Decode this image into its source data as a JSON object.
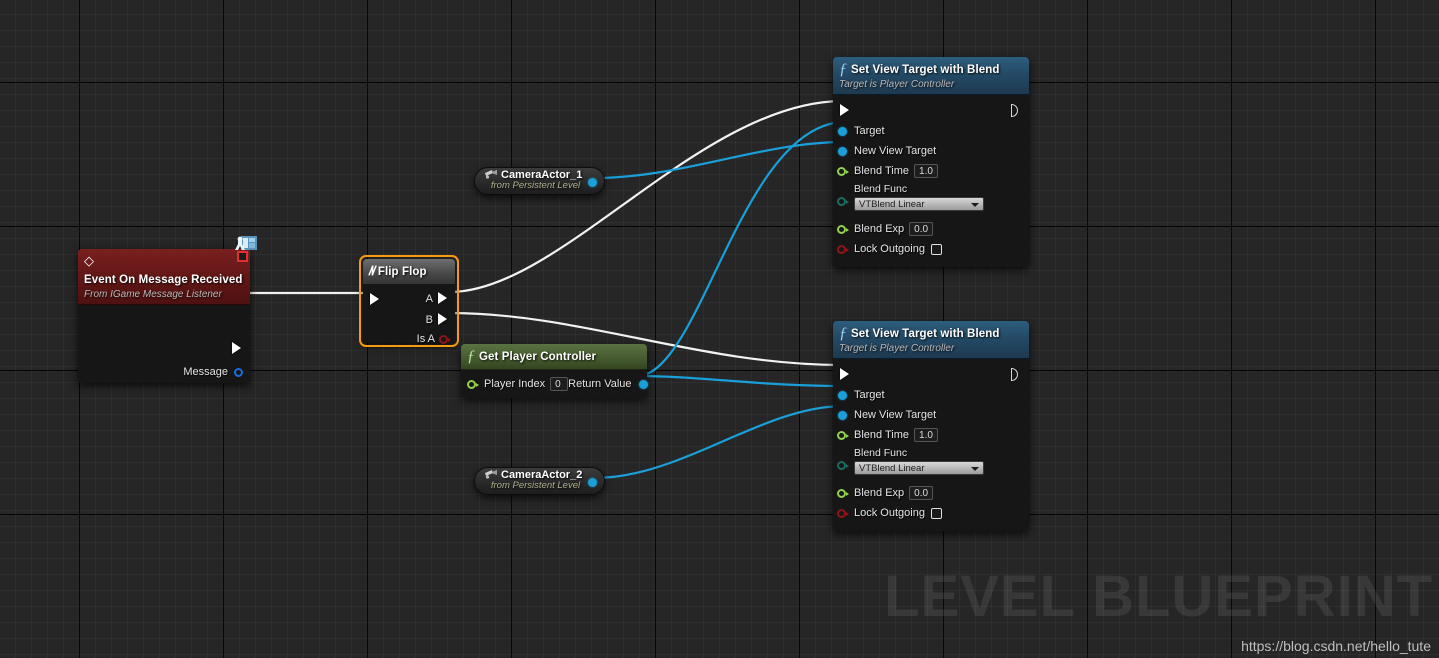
{
  "graph": {
    "watermark": "LEVEL BLUEPRINT",
    "url": "https://blog.csdn.net/hello_tute",
    "colors": {
      "exec_wire": "#f2f2f2",
      "object_wire": "#1a9fd8",
      "selection": "#f59b12",
      "header_function": "#2e5d7e",
      "header_pure": "#5a7342",
      "header_event": "#7a1f1f",
      "header_flow": "#6e6e6e",
      "pin_object": "#1a9fd8",
      "pin_float": "#92d050",
      "pin_enum": "#1b6b63",
      "pin_bool": "#8c1616",
      "canvas_bg": "#262626"
    }
  },
  "nodes": {
    "event": {
      "title": "Event On Message Received",
      "subtitle": "From IGame Message Listener",
      "icon": "event-diamond-icon",
      "badge": "blueprint-actor-badge-icon",
      "out_exec": "exec-out-pin",
      "message_pin_label": "Message"
    },
    "flipflop": {
      "title": "Flip Flop",
      "icon": "flow-control-icon",
      "selected": true,
      "in_exec": "exec-in-pin",
      "outputs": [
        {
          "label": "A",
          "type": "exec"
        },
        {
          "label": "B",
          "type": "exec"
        },
        {
          "label": "Is A",
          "type": "bool"
        }
      ]
    },
    "get_player_controller": {
      "title": "Get Player Controller",
      "icon": "pure-function-icon",
      "input_label": "Player Index",
      "input_value": "0",
      "output_label": "Return Value"
    },
    "camera_actors": [
      {
        "title": "CameraActor_1",
        "subtitle": "from Persistent Level",
        "icon": "camera-icon"
      },
      {
        "title": "CameraActor_2",
        "subtitle": "from Persistent Level",
        "icon": "camera-icon"
      }
    ],
    "set_view_target": [
      {
        "title": "Set View Target with Blend",
        "subtitle": "Target is Player Controller",
        "icon": "function-icon",
        "pins": [
          {
            "label": "Target",
            "type": "object"
          },
          {
            "label": "New View Target",
            "type": "object"
          },
          {
            "label": "Blend Time",
            "type": "float",
            "value": "1.0"
          },
          {
            "label": "Blend Func",
            "type": "enum",
            "value": "VTBlend Linear"
          },
          {
            "label": "Blend Exp",
            "type": "float",
            "value": "0.0"
          },
          {
            "label": "Lock Outgoing",
            "type": "bool",
            "value": false
          }
        ]
      },
      {
        "title": "Set View Target with Blend",
        "subtitle": "Target is Player Controller",
        "icon": "function-icon",
        "pins": [
          {
            "label": "Target",
            "type": "object"
          },
          {
            "label": "New View Target",
            "type": "object"
          },
          {
            "label": "Blend Time",
            "type": "float",
            "value": "1.0"
          },
          {
            "label": "Blend Func",
            "type": "enum",
            "value": "VTBlend Linear"
          },
          {
            "label": "Blend Exp",
            "type": "float",
            "value": "0.0"
          },
          {
            "label": "Lock Outgoing",
            "type": "bool",
            "value": false
          }
        ]
      }
    ]
  }
}
